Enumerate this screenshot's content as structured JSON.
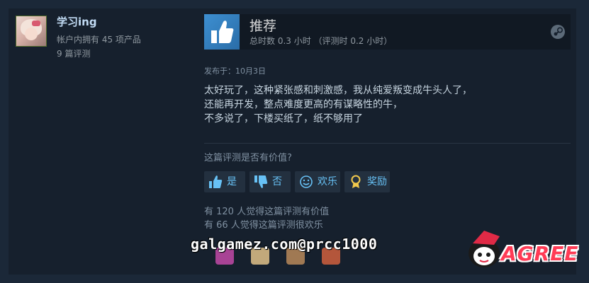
{
  "author": {
    "name": "学习ing",
    "products_owned": "帐户内拥有 45 项产品",
    "reviews_count": "9 篇评测"
  },
  "review": {
    "verdict": "推荐",
    "hours": "总时数 0.3 小时 （评测时 0.2 小时）",
    "posted": "发布于：10月3日",
    "body_lines": [
      "太好玩了，这种紧张感和刺激感，我从纯爱叛变成牛头人了，",
      "还能再开发，整点难度更高的有谋略性的牛，",
      "不多说了，下楼买纸了，纸不够用了"
    ],
    "helpful_question": "这篇评测是否有价值?",
    "buttons": {
      "yes": "是",
      "no": "否",
      "funny": "欢乐",
      "award": "奖励"
    },
    "helpful_count": "有 120 人觉得这篇评测有价值",
    "funny_count": "有 66 人觉得这篇评测很欢乐"
  },
  "overlay": {
    "watermark": "galgamez.com@prcc1000",
    "logo_text": "AGREE"
  },
  "icons": {
    "verdict": "thumbs-up-icon",
    "platform": "steam-icon",
    "yes": "thumbs-up-icon",
    "no": "thumbs-down-icon",
    "funny": "smiley-icon",
    "award": "award-ribbon-icon"
  },
  "colors": {
    "background": "#1b2838",
    "card": "#16202d",
    "link": "#67c1f5",
    "verdict_box": "#3d8fd1",
    "logo_red": "#ff3b56"
  }
}
